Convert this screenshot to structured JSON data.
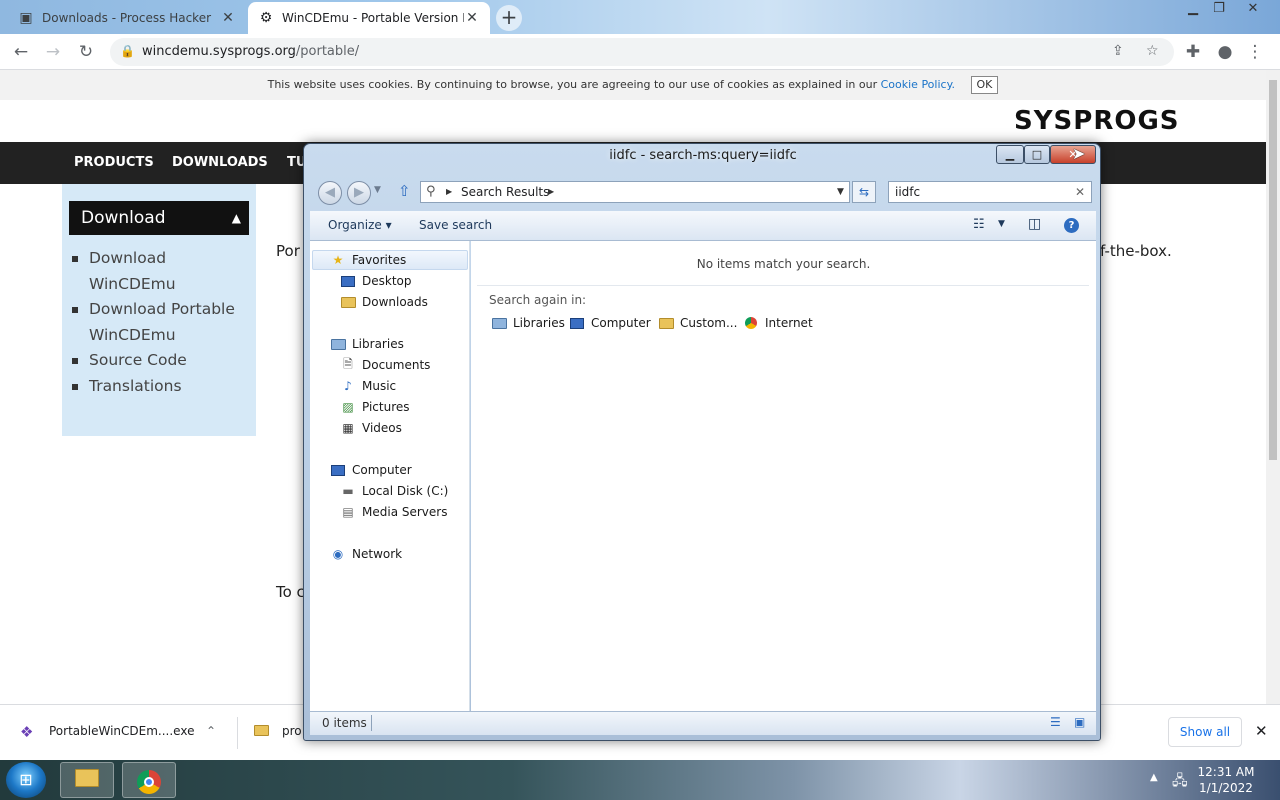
{
  "browser": {
    "tabs": [
      {
        "title": "Downloads - Process Hacker",
        "icon": "process-hacker-icon"
      },
      {
        "title": "WinCDEmu - Portable Version Do",
        "icon": "gear-icon"
      }
    ],
    "url_domain": "wincdemu.sysprogs.org",
    "url_path": "/portable/"
  },
  "page": {
    "cookie_text": "This website uses cookies. By continuing to browse, you are agreeing to our use of cookies as explained in our",
    "cookie_link": "Cookie Policy.",
    "cookie_ok": "OK",
    "logo": "SYSPROGS",
    "nav": [
      "PRODUCTS",
      "DOWNLOADS",
      "TU"
    ],
    "sidebar_title": "Download",
    "sidebar_links": [
      "Download WinCDEmu",
      "Download Portable WinCDEmu",
      "Source Code",
      "Translations"
    ],
    "text_left_1": "Por",
    "text_right_1": "f-the-box.",
    "text_left_2": "To c"
  },
  "downloads": {
    "item1": "PortableWinCDEm....exe",
    "item2": "pro",
    "show_all": "Show all"
  },
  "explorer": {
    "title": "iidfc - search-ms:query=iidfc",
    "breadcrumb": "Search Results",
    "search_value": "iidfc",
    "commands": {
      "organize": "Organize",
      "save_search": "Save search"
    },
    "nav": {
      "favorites": "Favorites",
      "desktop": "Desktop",
      "downloads": "Downloads",
      "libraries": "Libraries",
      "documents": "Documents",
      "music": "Music",
      "pictures": "Pictures",
      "videos": "Videos",
      "computer": "Computer",
      "local_disk": "Local Disk (C:)",
      "media_servers": "Media Servers",
      "network": "Network"
    },
    "no_items": "No items match your search.",
    "search_again": "Search again in:",
    "search_again_options": [
      "Libraries",
      "Computer",
      "Custom...",
      "Internet"
    ],
    "status": "0 items"
  },
  "taskbar": {
    "time": "12:31 AM",
    "date": "1/1/2022"
  }
}
